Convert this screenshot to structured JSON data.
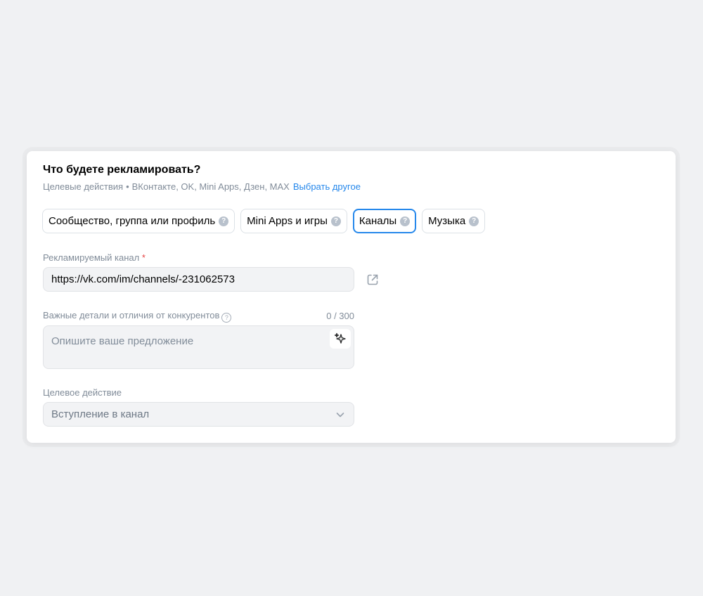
{
  "header": {
    "title": "Что будете рекламировать?",
    "subtitle_prefix": "Целевые действия",
    "subtitle_dot": "•",
    "subtitle_platforms": "ВКонтакте, OK, Mini Apps, Дзен, MAX",
    "choose_other_link": "Выбрать другое"
  },
  "tabs": [
    {
      "label": "Сообщество, группа или профиль",
      "active": false
    },
    {
      "label": "Mini Apps и игры",
      "active": false
    },
    {
      "label": "Каналы",
      "active": true
    },
    {
      "label": "Музыка",
      "active": false
    }
  ],
  "help_glyph": "?",
  "channel_field": {
    "label": "Рекламируемый канал",
    "required_mark": "*",
    "value": "https://vk.com/im/channels/-231062573"
  },
  "details_field": {
    "label": "Важные детали и отличия от конкурентов",
    "counter": "0 / 300",
    "placeholder": "Опишите ваше предложение"
  },
  "target_action": {
    "label": "Целевое действие",
    "selected": "Вступление в канал"
  },
  "colors": {
    "accent": "#2688eb",
    "required": "#e64646",
    "background": "#f0f1f3",
    "field_bg": "#f2f3f5"
  },
  "icons": {
    "help": "question-circle-icon",
    "external_link": "external-link-icon",
    "ai": "sparkles-icon",
    "dropdown": "chevron-down-icon"
  }
}
